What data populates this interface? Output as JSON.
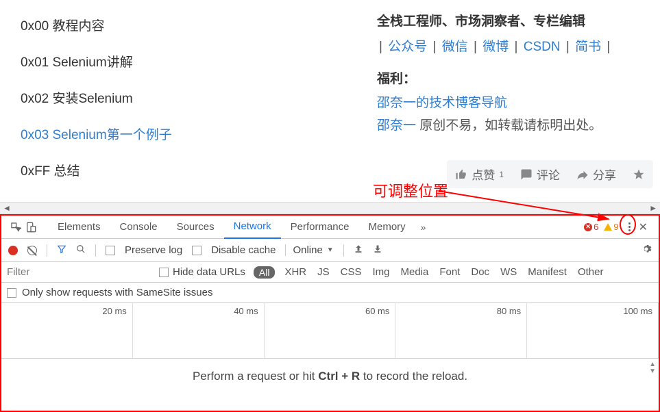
{
  "toc": {
    "items": [
      {
        "label": "0x00 教程内容"
      },
      {
        "label": "0x01 Selenium讲解"
      },
      {
        "label": "0x02 安装Selenium"
      },
      {
        "label": "0x03 Selenium第一个例子"
      },
      {
        "label": "0xFF 总结"
      }
    ],
    "active_index": 3
  },
  "sidebar": {
    "bio_title": "全栈工程师、市场洞察者、专栏编辑",
    "links": [
      "公众号",
      "微信",
      "微博",
      "CSDN",
      "简书"
    ],
    "welfare_label": "福利：",
    "nav_link": "邵奈一的技术博客导航",
    "author": "邵奈一",
    "reprint": " 原创不易，如转载请标明出处。"
  },
  "actions": {
    "like": "点赞",
    "like_count": "1",
    "comment": "评论",
    "share": "分享"
  },
  "annotation": "可调整位置",
  "devtools": {
    "tabs": [
      "Elements",
      "Console",
      "Sources",
      "Network",
      "Performance",
      "Memory"
    ],
    "active_tab": 3,
    "errors": "6",
    "warnings": "9",
    "net_toolbar": {
      "preserve_log": "Preserve log",
      "disable_cache": "Disable cache",
      "online": "Online"
    },
    "filter_placeholder": "Filter",
    "hide_urls": "Hide data URLs",
    "filter_all": "All",
    "filter_types": [
      "XHR",
      "JS",
      "CSS",
      "Img",
      "Media",
      "Font",
      "Doc",
      "WS",
      "Manifest",
      "Other"
    ],
    "samesite": "Only show requests with SameSite issues",
    "timeline": [
      "20 ms",
      "40 ms",
      "60 ms",
      "80 ms",
      "100 ms"
    ],
    "empty_msg_pre": "Perform a request or hit ",
    "empty_msg_key": "Ctrl + R",
    "empty_msg_post": " to record the reload."
  }
}
